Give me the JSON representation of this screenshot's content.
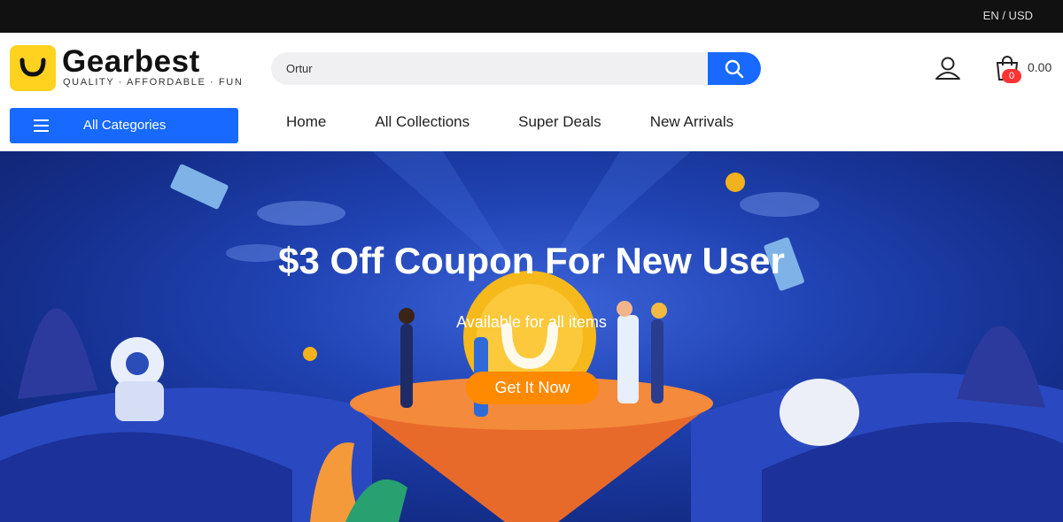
{
  "topbar": {
    "locale": "EN / USD"
  },
  "brand": {
    "name": "Gearbest",
    "tagline": "QUALITY · AFFORDABLE · FUN",
    "accent": "#ffd21f"
  },
  "search": {
    "value": "Ortur",
    "button_icon": "search-icon",
    "button_color": "#1769ff"
  },
  "account": {
    "icon": "user-icon"
  },
  "cart": {
    "icon": "shopping-bag-icon",
    "count": "0",
    "total": "0.00"
  },
  "categories": {
    "label": "All Categories",
    "icon": "menu-icon"
  },
  "nav": {
    "items": [
      "Home",
      "All Collections",
      "Super Deals",
      "New Arrivals"
    ]
  },
  "hero": {
    "title": "$3 Off Coupon For New User",
    "subtitle": "Available for all items",
    "cta": "Get It Now",
    "cta_color": "#ff8a00"
  }
}
